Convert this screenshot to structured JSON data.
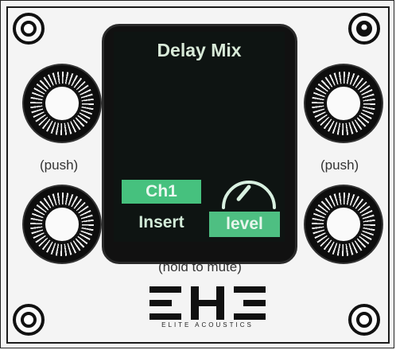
{
  "screen": {
    "title": "Delay Mix",
    "channel_label": "Ch1",
    "mode_label": "Insert",
    "parameter_label": "level",
    "dial_value": 0.8
  },
  "captions": {
    "left_push": "(push)",
    "right_push": "(push)",
    "hold_to_mute": "(hold to mute)"
  },
  "brand": {
    "logo_text": "ELITE ACOUSTICS"
  },
  "colors": {
    "accent": "#4ebf82",
    "screen_background": "#0e1412",
    "panel": "#f4f4f4"
  },
  "icons": {
    "top_left_screw": "screw-icon",
    "top_right_screw": "screw-icon",
    "bottom_left_screw": "screw-icon",
    "bottom_right_screw": "screw-icon",
    "dial": "level-dial-icon"
  }
}
